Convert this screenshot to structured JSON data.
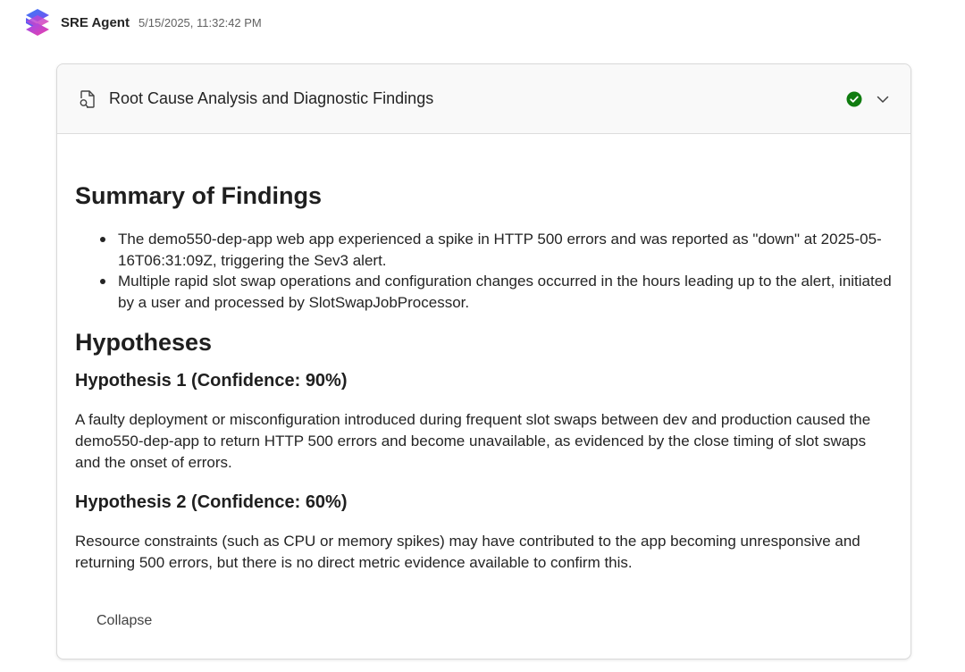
{
  "message": {
    "agent_name": "SRE Agent",
    "timestamp": "5/15/2025, 11:32:42 PM",
    "logo_icon": "sre-agent-logo"
  },
  "card": {
    "title": "Root Cause Analysis and Diagnostic Findings",
    "title_icon": "document-search-icon",
    "status": "completed",
    "status_color": "#107c10",
    "toggle_icon": "chevron-down-icon",
    "collapse_label": "Collapse"
  },
  "summary": {
    "heading": "Summary of Findings",
    "items": [
      "The demo550-dep-app web app experienced a spike in HTTP 500 errors and was reported as \"down\" at 2025-05-16T06:31:09Z, triggering the Sev3 alert.",
      "Multiple rapid slot swap operations and configuration changes occurred in the hours leading up to the alert, initiated by a user and processed by SlotSwapJobProcessor."
    ]
  },
  "hypotheses": {
    "heading": "Hypotheses",
    "items": [
      {
        "title": "Hypothesis 1 (Confidence: 90%)",
        "text": "A faulty deployment or misconfiguration introduced during frequent slot swaps between dev and production caused the demo550-dep-app to return HTTP 500 errors and become unavailable, as evidenced by the close timing of slot swaps and the onset of errors."
      },
      {
        "title": "Hypothesis 2 (Confidence: 60%)",
        "text": "Resource constraints (such as CPU or memory spikes) may have contributed to the app becoming unresponsive and returning 500 errors, but there is no direct metric evidence available to confirm this."
      }
    ]
  }
}
